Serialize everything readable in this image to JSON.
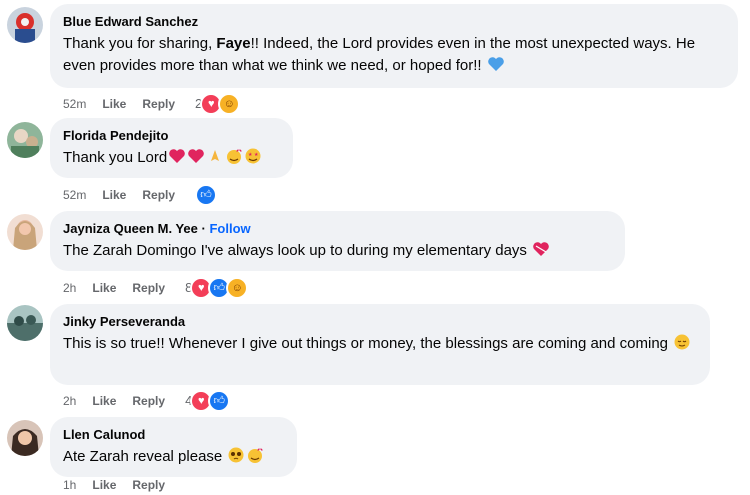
{
  "comments": [
    {
      "author": "Blue Edward Sanchez",
      "text_a": "Thank you for sharing, ",
      "text_mention": "Faye",
      "text_b": "!! Indeed, the Lord provides even in the most unexpected ways. He even provides more than what we think we need, or hoped for!!",
      "time": "52m",
      "like": "Like",
      "reply": "Reply",
      "reaction_count": "2"
    },
    {
      "author": "Florida Pendejito",
      "text": "Thank you Lord",
      "time": "52m",
      "like": "Like",
      "reply": "Reply"
    },
    {
      "author": "Jayniza Queen M. Yee",
      "separator": "·",
      "follow": "Follow",
      "text": "The Zarah Domingo I've always look up to during my elementary days",
      "time": "2h",
      "like": "Like",
      "reply": "Reply",
      "reaction_count": "8"
    },
    {
      "author": "Jinky Perseveranda",
      "text": "This is so true!! Whenever I give out things or money, the blessings are coming and coming",
      "time": "2h",
      "like": "Like",
      "reply": "Reply",
      "reaction_count": "4"
    },
    {
      "author": "Llen Calunod",
      "text": "Ate Zarah reveal please",
      "time": "1h",
      "like": "Like",
      "reply": "Reply"
    }
  ],
  "colors": {
    "bubble": "#f0f2f5",
    "meta": "#65676b",
    "link": "#0866ff",
    "love": "#f33e58",
    "like": "#1877f2",
    "care": "#f7b125"
  }
}
